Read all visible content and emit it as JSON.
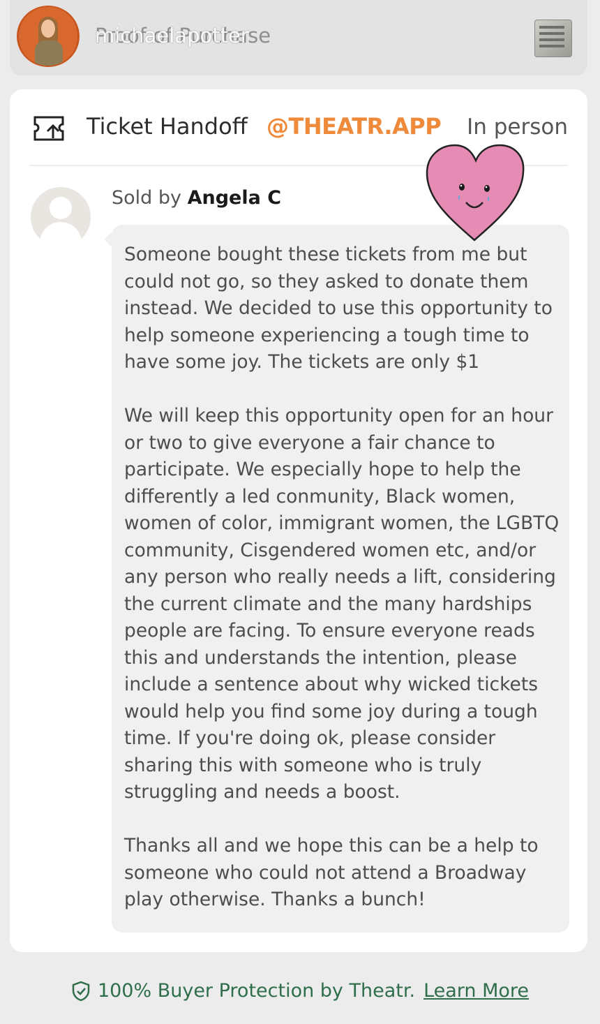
{
  "header": {
    "username": "michaelapotter",
    "title": "Proof of Purchase"
  },
  "listing": {
    "type_label": "Ticket Handoff",
    "watermark": "@THEATR.APP",
    "delivery": "In person",
    "sold_by_prefix": "Sold by",
    "seller_name": "Angela C",
    "message": "Someone bought these tickets from me but could not go, so they asked to donate them instead. We decided to use this opportunity to help someone experiencing a tough time to have some joy. The tickets are only $1\n\nWe will keep this opportunity open for an hour or two to give everyone a fair chance to participate. We especially hope to help the differently a led conmunity, Black women, women of color, immigrant women, the LGBTQ community, Cisgendered women etc, and/or any person who really needs a lift, considering the current climate and the many hardships people are facing. To ensure everyone reads this and understands the intention, please include a sentence about why wicked tickets would help you find some joy during a tough time. If you're doing ok, please consider sharing this with someone who is truly struggling and needs a boost.\n\nThanks all and we hope this can be a help to someone who could not attend a Broadway play otherwise. Thanks a bunch!"
  },
  "footer": {
    "protection_text": "100% Buyer Protection by Theatr.",
    "learn_more": "Learn More"
  },
  "colors": {
    "accent_orange": "#ee8a3a",
    "footer_green": "#2f6e4b",
    "heart_pink": "#e68bb3"
  },
  "icons": [
    "ticket-handoff-icon",
    "shield-check-icon",
    "heart-sticker"
  ]
}
